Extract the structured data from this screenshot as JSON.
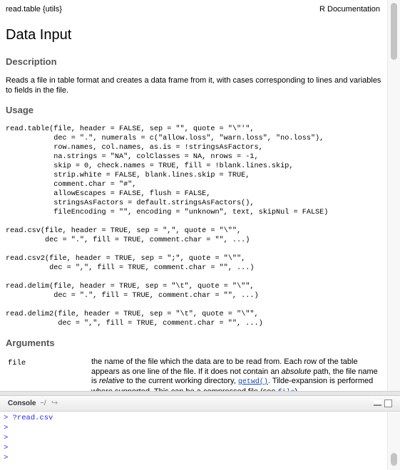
{
  "help": {
    "package_label": "read.table {utils}",
    "doc_label": "R Documentation",
    "title": "Data Input",
    "description_heading": "Description",
    "description_text": "Reads a file in table format and creates a data frame from it, with cases corresponding to lines and variables to fields in the file.",
    "usage_heading": "Usage",
    "usage_blocks": [
      "read.table(file, header = FALSE, sep = \"\", quote = \"\\\"'\",\n           dec = \".\", numerals = c(\"allow.loss\", \"warn.loss\", \"no.loss\"),\n           row.names, col.names, as.is = !stringsAsFactors,\n           na.strings = \"NA\", colClasses = NA, nrows = -1,\n           skip = 0, check.names = TRUE, fill = !blank.lines.skip,\n           strip.white = FALSE, blank.lines.skip = TRUE,\n           comment.char = \"#\",\n           allowEscapes = FALSE, flush = FALSE,\n           stringsAsFactors = default.stringsAsFactors(),\n           fileEncoding = \"\", encoding = \"unknown\", text, skipNul = FALSE)",
      "read.csv(file, header = TRUE, sep = \",\", quote = \"\\\"\",\n         dec = \".\", fill = TRUE, comment.char = \"\", ...)",
      "read.csv2(file, header = TRUE, sep = \";\", quote = \"\\\"\",\n          dec = \",\", fill = TRUE, comment.char = \"\", ...)",
      "read.delim(file, header = TRUE, sep = \"\\t\", quote = \"\\\"\",\n           dec = \".\", fill = TRUE, comment.char = \"\", ...)",
      "read.delim2(file, header = TRUE, sep = \"\\t\", quote = \"\\\"\",\n            dec = \",\", fill = TRUE, comment.char = \"\", ...)"
    ],
    "arguments_heading": "Arguments",
    "arg_name": "file",
    "arg_desc_1": "the name of the file which the data are to be read from. Each row of the table appears as one line of the file. If it does not contain an ",
    "arg_desc_em1": "absolute",
    "arg_desc_2": " path, the file name is ",
    "arg_desc_em2": "relative",
    "arg_desc_3": " to the current working directory, ",
    "arg_desc_link1": "getwd",
    "arg_desc_link1_suffix": "()",
    "arg_desc_4": ". Tilde-expansion is performed where supported. This can be a compressed file (see ",
    "arg_desc_link2": "file",
    "arg_desc_5": ")."
  },
  "console": {
    "title": "Console",
    "path": "~/",
    "lines": [
      {
        "prompt": ">",
        "text": " ?read.csv"
      },
      {
        "prompt": ">",
        "text": ""
      },
      {
        "prompt": ">",
        "text": ""
      },
      {
        "prompt": ">",
        "text": ""
      },
      {
        "prompt": ">",
        "text": ""
      }
    ]
  },
  "colors": {
    "prompt": "#2a2ae6",
    "link": "#1a4ba8",
    "section_heading": "#555555"
  }
}
